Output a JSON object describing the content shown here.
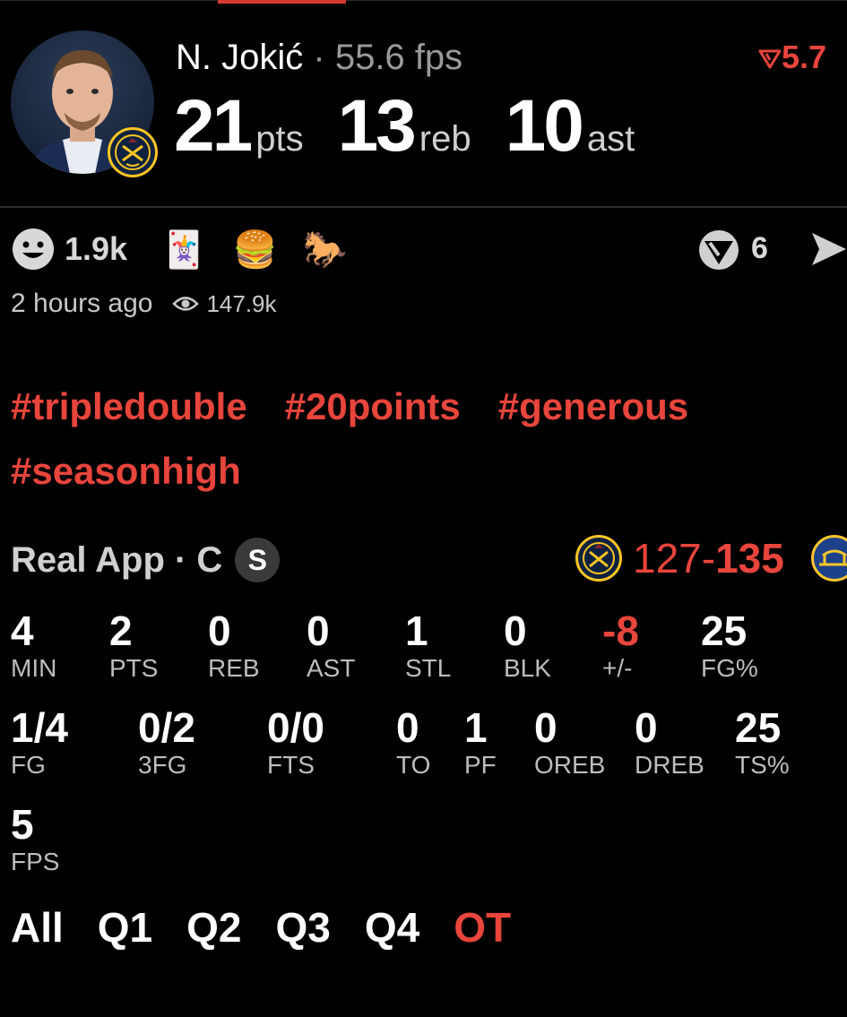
{
  "header": {
    "player_name": "N. Jokić",
    "separator": "·",
    "fps_text": "55.6 fps",
    "trend_value": "5.7",
    "stats": [
      {
        "value": "21",
        "unit": "pts"
      },
      {
        "value": "13",
        "unit": "reb"
      },
      {
        "value": "10",
        "unit": "ast"
      }
    ]
  },
  "reactions": {
    "count": "1.9k",
    "emojis": [
      "🃏",
      "🍔",
      "🐎"
    ],
    "share_count": "6"
  },
  "meta": {
    "time": "2 hours ago",
    "views": "147.9k"
  },
  "hashtags": [
    "#tripledouble",
    "#20points",
    "#generous",
    "#seasonhigh"
  ],
  "game": {
    "app_label": "Real App · C",
    "badge": "S",
    "score_left": "127",
    "score_dash": "-",
    "score_right": "135"
  },
  "stats_row1": [
    {
      "value": "4",
      "label": "MIN"
    },
    {
      "value": "2",
      "label": "PTS"
    },
    {
      "value": "0",
      "label": "REB"
    },
    {
      "value": "0",
      "label": "AST"
    },
    {
      "value": "1",
      "label": "STL"
    },
    {
      "value": "0",
      "label": "BLK"
    },
    {
      "value": "-8",
      "label": "+/-"
    },
    {
      "value": "25",
      "label": "FG%"
    }
  ],
  "stats_row2": [
    {
      "value": "1/4",
      "label": "FG"
    },
    {
      "value": "0/2",
      "label": "3FG"
    },
    {
      "value": "0/0",
      "label": "FTS"
    },
    {
      "value": "0",
      "label": "TO"
    },
    {
      "value": "1",
      "label": "PF"
    },
    {
      "value": "0",
      "label": "OREB"
    },
    {
      "value": "0",
      "label": "DREB"
    },
    {
      "value": "25",
      "label": "TS%"
    }
  ],
  "stats_row3": [
    {
      "value": "5",
      "label": "FPS"
    }
  ],
  "quarters": {
    "items": [
      "All",
      "Q1",
      "Q2",
      "Q3",
      "Q4",
      "OT"
    ],
    "active": "OT"
  },
  "colors": {
    "accent": "#e8453c",
    "background": "#000000",
    "nuggets_navy": "#0e2240",
    "nuggets_gold": "#fec524",
    "warriors_blue": "#1d428a"
  }
}
